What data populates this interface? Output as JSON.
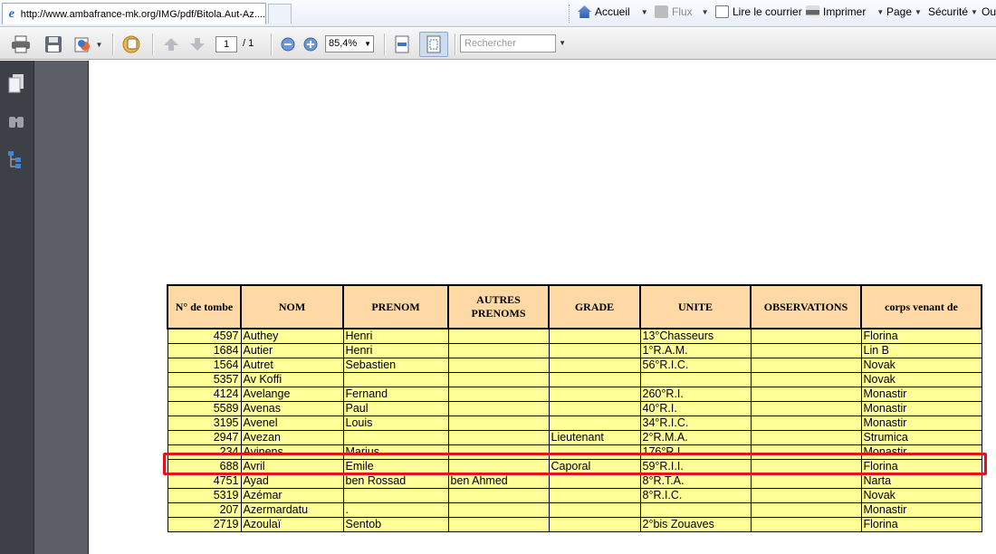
{
  "browser": {
    "tab_title": "http://www.ambafrance-mk.org/IMG/pdf/Bitola.Aut-Az....",
    "commands": {
      "home": "Accueil",
      "feeds": "Flux",
      "read_mail": "Lire le courrier",
      "print": "Imprimer",
      "page": "Page",
      "security": "Sécurité",
      "tools": "Out"
    }
  },
  "pdf_toolbar": {
    "page_current": "1",
    "page_total": "/ 1",
    "zoom": "85,4%",
    "search_placeholder": "Rechercher"
  },
  "icons": {
    "print": "printer-icon",
    "save": "save-icon",
    "share": "share-icon",
    "hand": "hand-icon",
    "prev": "arrow-up-icon",
    "next": "arrow-down-icon",
    "zoom_out": "zoom-out-icon",
    "zoom_in": "zoom-in-icon",
    "fit_width": "fit-width-icon",
    "fit_page": "fit-page-icon",
    "pages_panel": "pages-icon",
    "attachments_panel": "binoculars-icon",
    "bookmarks_panel": "bookmarks-icon"
  },
  "table": {
    "headers": [
      "N° de tombe",
      "NOM",
      "PRENOM",
      "AUTRES PRENOMS",
      "GRADE",
      "UNITE",
      "OBSERVATIONS",
      "corps venant de"
    ],
    "rows": [
      [
        "4597",
        "Authey",
        "Henri",
        "",
        "",
        "13°Chasseurs",
        "",
        "Florina"
      ],
      [
        "1684",
        "Autier",
        "Henri",
        "",
        "",
        "1°R.A.M.",
        "",
        "Lin B"
      ],
      [
        "1564",
        "Autret",
        "Sebastien",
        "",
        "",
        "56°R.I.C.",
        "",
        "Novak"
      ],
      [
        "5357",
        "Av Koffi",
        "",
        "",
        "",
        "",
        "",
        " Novak"
      ],
      [
        "4124",
        "Avelange",
        "Fernand",
        "",
        "",
        "260°R.I.",
        "",
        "Monastir"
      ],
      [
        "5589",
        "Avenas",
        "Paul",
        "",
        "",
        "40°R.I.",
        "",
        "Monastir"
      ],
      [
        "3195",
        "Avenel",
        "Louis",
        "",
        "",
        "34°R.I.C.",
        "",
        "Monastir"
      ],
      [
        "2947",
        "Avezan",
        "",
        "",
        "Lieutenant",
        "2°R.M.A.",
        "",
        "Strumica"
      ],
      [
        "234",
        "Avinens",
        "Marius",
        "",
        "",
        "176°R.I.",
        "",
        "Monastir"
      ],
      [
        "688",
        "Avril",
        "Emile",
        "",
        "Caporal",
        "59°R.I.I.",
        "",
        "Florina"
      ],
      [
        "4751",
        "Ayad",
        "ben Rossad",
        "ben Ahmed",
        "",
        "8°R.T.A.",
        "",
        "Narta"
      ],
      [
        "5319",
        "Azémar",
        "",
        "",
        "",
        "8°R.I.C.",
        "",
        "Novak"
      ],
      [
        "207",
        "Azermardatu",
        ".",
        "",
        "",
        "",
        "",
        " Monastir"
      ],
      [
        "2719",
        "Azoulaï",
        "Sentob",
        "",
        "",
        "2°bis Zouaves",
        "",
        "Florina"
      ]
    ],
    "highlighted_row": 9,
    "colors": {
      "header_bg": "#fed9a5",
      "cell_bg": "#ffff99",
      "highlight": "#e0141c"
    }
  }
}
